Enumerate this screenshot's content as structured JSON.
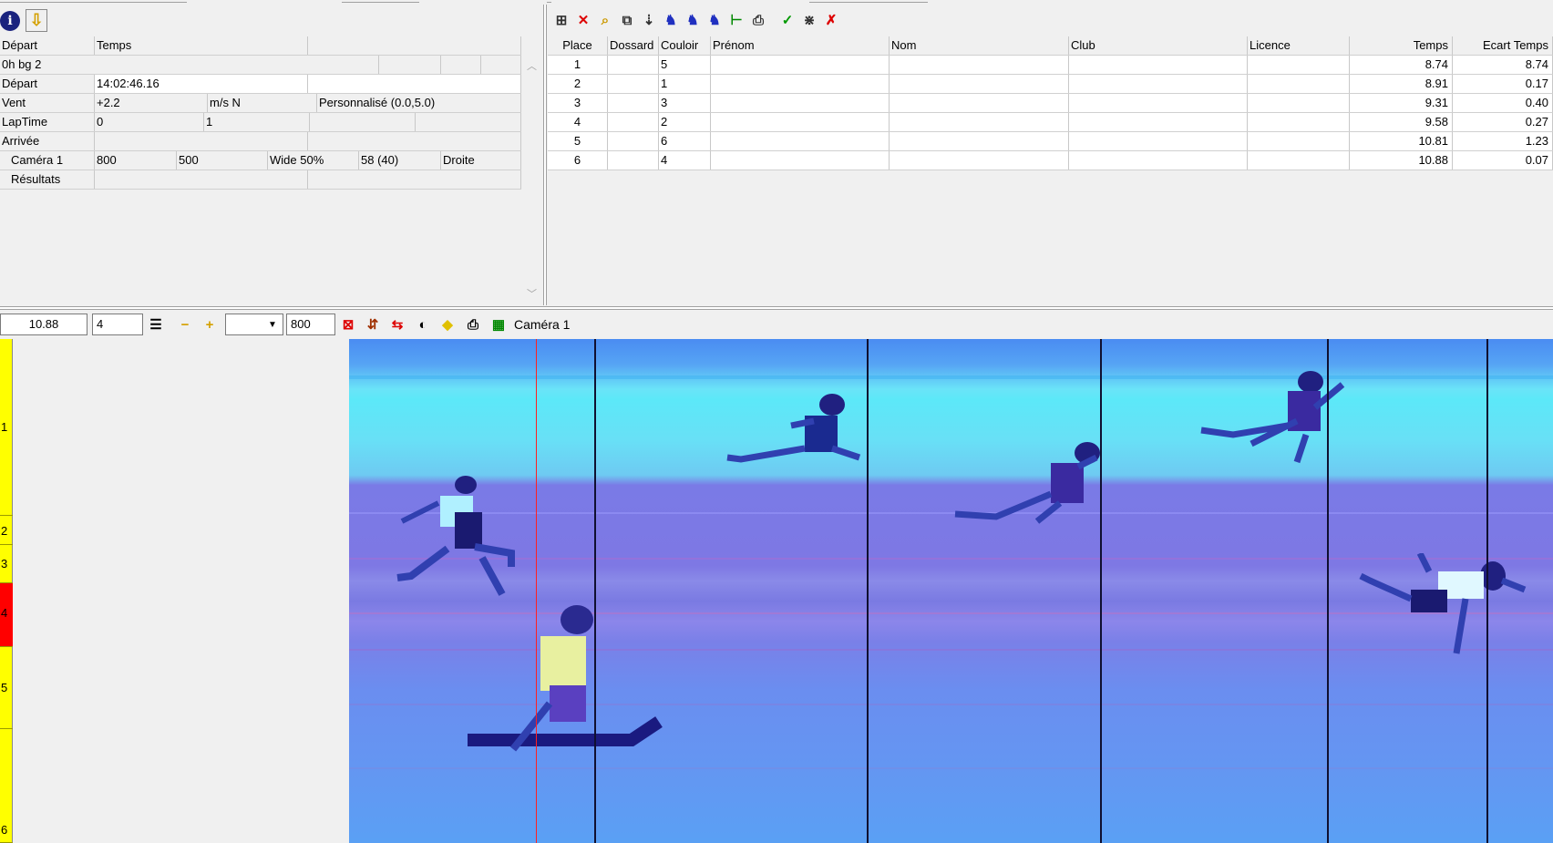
{
  "left_panel": {
    "header": [
      "Départ",
      "Temps"
    ],
    "race_name": "0h bg 2",
    "start": {
      "label": "Départ",
      "time": "14:02:46.16"
    },
    "wind": {
      "label": "Vent",
      "value": "+2.2",
      "unit": "m/s N",
      "mode": "Personnalisé (0.0,5.0)"
    },
    "laptime": {
      "label": "LapTime",
      "a": "0",
      "b": "1"
    },
    "arrival": {
      "label": "Arrivée"
    },
    "camera": {
      "label": "Caméra 1",
      "v1": "800",
      "v2": "500",
      "v3": "Wide 50%",
      "v4": "58  (40)",
      "v5": "Droite"
    },
    "results": {
      "label": "Résultats"
    }
  },
  "results_table": {
    "columns": [
      "Place",
      "Dossard",
      "Couloir",
      "Prénom",
      "Nom",
      "Club",
      "Licence",
      "Temps",
      "Ecart Temps"
    ],
    "rows": [
      {
        "place": "1",
        "dossard": "",
        "couloir": "5",
        "prenom": "",
        "nom": "",
        "club": "",
        "licence": "",
        "temps": "8.74",
        "ecart": "8.74"
      },
      {
        "place": "2",
        "dossard": "",
        "couloir": "1",
        "prenom": "",
        "nom": "",
        "club": "",
        "licence": "",
        "temps": "8.91",
        "ecart": "0.17"
      },
      {
        "place": "3",
        "dossard": "",
        "couloir": "3",
        "prenom": "",
        "nom": "",
        "club": "",
        "licence": "",
        "temps": "9.31",
        "ecart": "0.40"
      },
      {
        "place": "4",
        "dossard": "",
        "couloir": "2",
        "prenom": "",
        "nom": "",
        "club": "",
        "licence": "",
        "temps": "9.58",
        "ecart": "0.27"
      },
      {
        "place": "5",
        "dossard": "",
        "couloir": "6",
        "prenom": "",
        "nom": "",
        "club": "",
        "licence": "",
        "temps": "10.81",
        "ecart": "1.23"
      },
      {
        "place": "6",
        "dossard": "",
        "couloir": "4",
        "prenom": "",
        "nom": "",
        "club": "",
        "licence": "",
        "temps": "10.88",
        "ecart": "0.07"
      }
    ]
  },
  "image_toolbar": {
    "time": "10.88",
    "lane": "4",
    "combo": "",
    "width": "800",
    "camera": "Caméra 1"
  },
  "lanes": [
    "1",
    "2",
    "3",
    "4",
    "5",
    "6"
  ],
  "selected_lane": "4",
  "colors": {
    "lane_bg": "#ffff00",
    "lane_selected": "#ff0000",
    "cursor_line": "#ff2020"
  },
  "icons": {
    "results_toolbar": [
      "select-icon",
      "delete-icon",
      "zoom-icon",
      "layers-icon",
      "sort-icon",
      "runner-icon",
      "runner2-icon",
      "runner3-icon",
      "tree-icon",
      "print-icon",
      "check-icon",
      "split-icon",
      "close-icon"
    ],
    "image_toolbar": [
      "settings-icon",
      "zoom-out-icon",
      "zoom-in-icon",
      "delete-icon",
      "adjust-icon",
      "compare-icon",
      "contrast-icon",
      "diamond-icon",
      "print-icon",
      "grid-icon"
    ]
  }
}
